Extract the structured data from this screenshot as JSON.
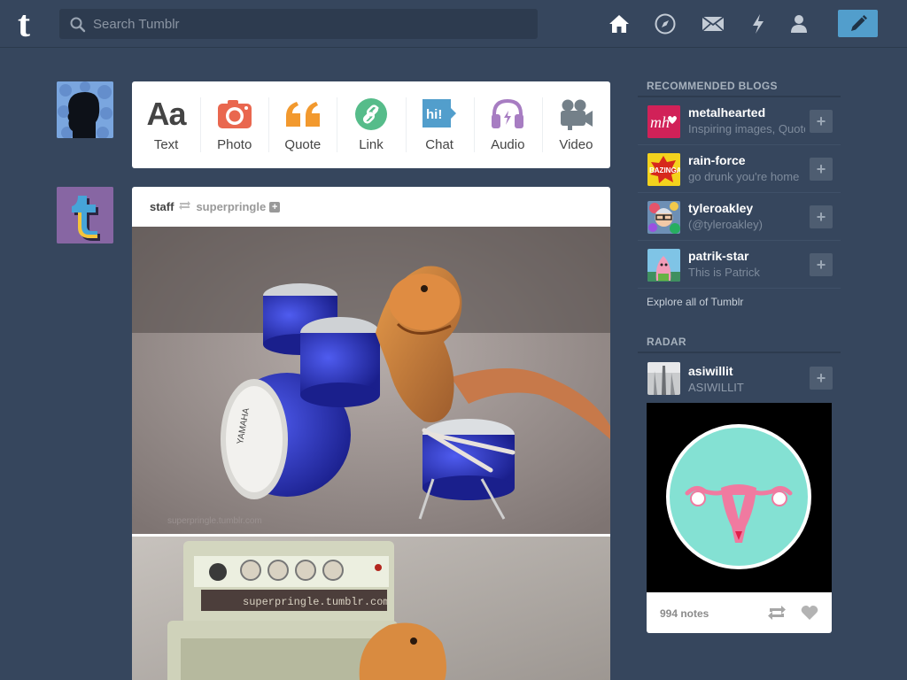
{
  "header": {
    "logo_letter": "t",
    "search_placeholder": "Search Tumblr",
    "nav": [
      "home-icon",
      "explore-icon",
      "inbox-icon",
      "activity-icon",
      "account-icon"
    ],
    "compose": "compose-icon"
  },
  "post_types": [
    {
      "label": "Text",
      "icon": "text-icon"
    },
    {
      "label": "Photo",
      "icon": "camera-icon"
    },
    {
      "label": "Quote",
      "icon": "quote-icon"
    },
    {
      "label": "Link",
      "icon": "link-icon"
    },
    {
      "label": "Chat",
      "icon": "chat-icon",
      "glyph": "hi!"
    },
    {
      "label": "Audio",
      "icon": "headphones-icon"
    },
    {
      "label": "Video",
      "icon": "video-camera-icon"
    }
  ],
  "post": {
    "author": "staff",
    "source": "superpringle",
    "photo2_watermark": "superpringle.tumblr.com",
    "photo1_watermark": "superpringle.tumblr.com"
  },
  "sidebar": {
    "recommended_title": "RECOMMENDED BLOGS",
    "blogs": [
      {
        "name": "metalhearted",
        "desc": "Inspiring images, Quotes",
        "avatar_text": "mh"
      },
      {
        "name": "rain-force",
        "desc": "go drunk you're home",
        "avatar_text": "BAZINGA"
      },
      {
        "name": "tyleroakley",
        "desc": "(@tyleroakley)"
      },
      {
        "name": "patrik-star",
        "desc": "This is Patrick"
      }
    ],
    "explore": "Explore all of Tumblr",
    "radar_title": "RADAR",
    "radar": {
      "name": "asiwillit",
      "desc": "ASIWILLIT",
      "notes": "994 notes"
    }
  },
  "colors": {
    "background": "#36465d",
    "compose": "#529ecc",
    "card": "#ffffff"
  }
}
